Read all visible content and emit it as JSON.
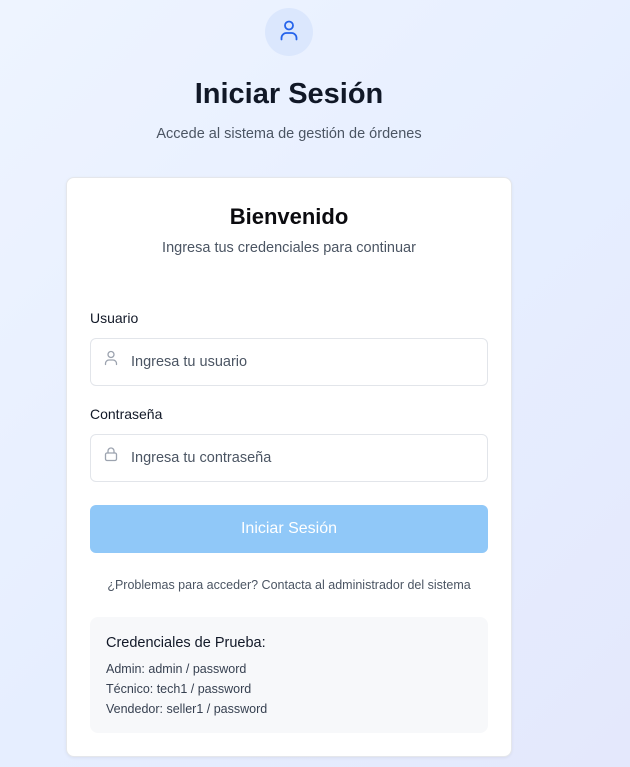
{
  "header": {
    "icon": "user-icon",
    "title": "Iniciar Sesión",
    "subtitle": "Accede al sistema de gestión de órdenes"
  },
  "card": {
    "title": "Bienvenido",
    "subtitle": "Ingresa tus credenciales para continuar"
  },
  "form": {
    "username": {
      "label": "Usuario",
      "placeholder": "Ingresa tu usuario",
      "value": "",
      "icon": "user-icon"
    },
    "password": {
      "label": "Contraseña",
      "placeholder": "Ingresa tu contraseña",
      "value": "",
      "icon": "lock-icon"
    },
    "submit_label": "Iniciar Sesión"
  },
  "help_text": "¿Problemas para acceder? Contacta al administrador del sistema",
  "test_credentials": {
    "title": "Credenciales de Prueba:",
    "lines": [
      "Admin: admin / password",
      "Técnico: tech1 / password",
      "Vendedor: seller1 / password"
    ]
  },
  "colors": {
    "accent": "#2563eb",
    "button_disabled": "#90c8f8",
    "avatar_bg": "#dbe7fd"
  }
}
